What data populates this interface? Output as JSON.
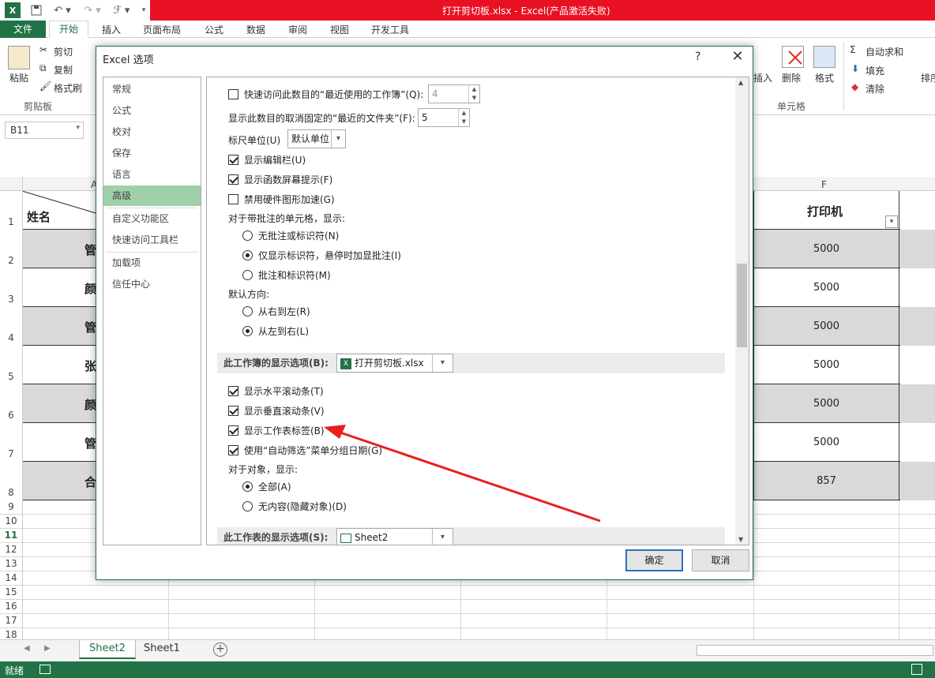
{
  "window": {
    "title": "打开剪切板.xlsx -  Excel(产品激活失败)"
  },
  "ribbon_tabs": [
    "文件",
    "开始",
    "插入",
    "页面布局",
    "公式",
    "数据",
    "审阅",
    "视图",
    "开发工具"
  ],
  "clipboard": {
    "paste": "粘贴",
    "cut": "剪切",
    "copy": "复制",
    "format_painter": "格式刷",
    "group": "剪贴板"
  },
  "cells_group": {
    "insert": "插入",
    "delete": "删除",
    "format": "格式",
    "group": "单元格"
  },
  "editing_group": {
    "autosum": "自动求和",
    "fill": "填充",
    "clear": "清除",
    "sort": "排序"
  },
  "name_box": "B11",
  "sheet": {
    "col_f_header": "F",
    "col_a_partial": "A",
    "header_a": "姓名",
    "header_f": "打印机",
    "rows": [
      {
        "num": "1"
      },
      {
        "num": "2",
        "a": "管",
        "f": "5000"
      },
      {
        "num": "3",
        "a": "颜",
        "f": "5000"
      },
      {
        "num": "4",
        "a": "管",
        "f": "5000"
      },
      {
        "num": "5",
        "a": "张",
        "f": "5000"
      },
      {
        "num": "6",
        "a": "颜",
        "f": "5000"
      },
      {
        "num": "7",
        "a": "管",
        "f": "5000"
      },
      {
        "num": "8",
        "a": "合",
        "f": "857"
      }
    ],
    "empty_rows": [
      "9",
      "10",
      "11",
      "12",
      "13",
      "14",
      "15",
      "16",
      "17",
      "18"
    ]
  },
  "sheet_tabs": [
    "Sheet2",
    "Sheet1"
  ],
  "status": "就绪",
  "dialog": {
    "title": "Excel 选项",
    "help": "?",
    "nav": [
      "常规",
      "公式",
      "校对",
      "保存",
      "语言",
      "高级",
      "自定义功能区",
      "快速访问工具栏",
      "加载项",
      "信任中心"
    ],
    "selected_nav": "高级",
    "options": {
      "recent_workbooks": "快速访问此数目的“最近使用的工作簿”(Q):",
      "recent_workbooks_value": "4",
      "recent_folders": "显示此数目的取消固定的“最近的文件夹”(F):",
      "recent_folders_value": "5",
      "ruler_units": "标尺单位(U)",
      "ruler_units_value": "默认单位",
      "show_formula_bar": "显示编辑栏(U)",
      "show_function_tips": "显示函数屏幕提示(F)",
      "disable_hw_accel": "禁用硬件图形加速(G)",
      "comments_label": "对于带批注的单元格，显示:",
      "no_comments": "无批注或标识符(N)",
      "indicators_only": "仅显示标识符，悬停时加显批注(I)",
      "comments_and_indicators": "批注和标识符(M)",
      "direction_label": "默认方向:",
      "right_to_left": "从右到左(R)",
      "left_to_right": "从左到右(L)",
      "workbook_section": "此工作簿的显示选项(B):",
      "workbook_file": "打开剪切板.xlsx",
      "show_hscroll": "显示水平滚动条(T)",
      "show_vscroll": "显示垂直滚动条(V)",
      "show_sheet_tabs": "显示工作表标签(B)",
      "group_dates": "使用“自动筛选”菜单分组日期(G)",
      "objects_label": "对于对象，显示:",
      "all": "全部(A)",
      "nothing": "无内容(隐藏对象)(D)",
      "worksheet_section": "此工作表的显示选项(S):",
      "worksheet_name": "Sheet2"
    },
    "ok": "确定",
    "cancel": "取消"
  },
  "colors": {
    "excel_green": "#217346",
    "title_red": "#e81123",
    "nav_selected": "#9fd0a8",
    "arrow_red": "#e8201a"
  }
}
